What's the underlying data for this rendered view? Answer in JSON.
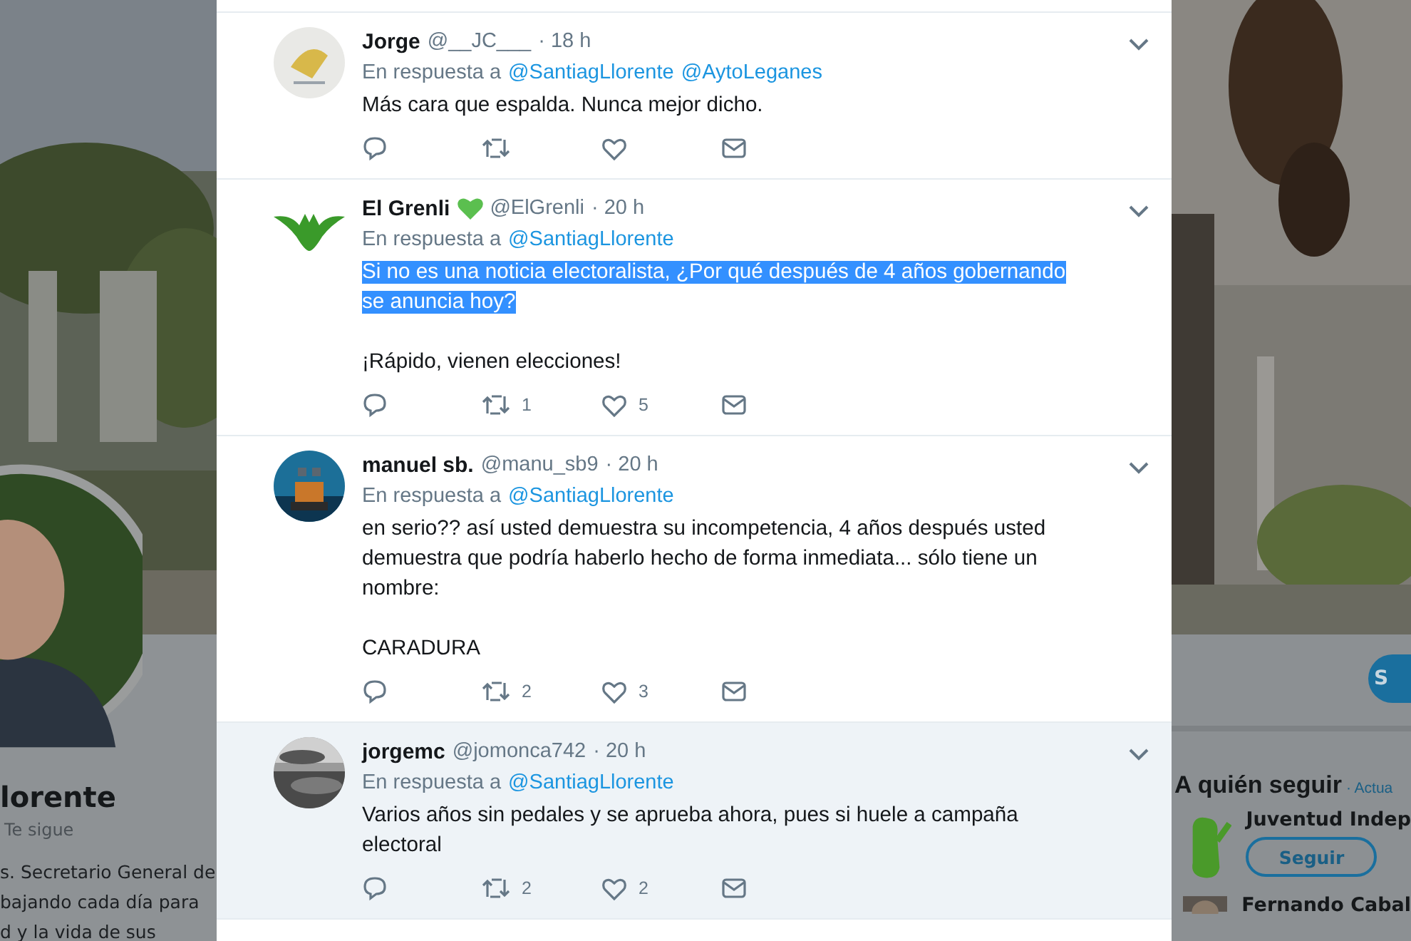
{
  "profile_backdrop": {
    "name": "lorente",
    "follows_you": "Te sigue",
    "bio_lines": [
      "s. Secretario General de",
      "bajando cada día para",
      "d y la vida de sus"
    ]
  },
  "sidebar": {
    "action_button": "S",
    "who_to_follow": {
      "title": "A quién seguir",
      "refresh": "· Actua",
      "accounts": [
        {
          "name": "Juventud Indep",
          "follow_button": "Seguir"
        },
        {
          "name": "Fernando Cabal"
        }
      ]
    }
  },
  "replies": [
    {
      "name": "Jorge",
      "handle": "@__JC___",
      "time": "· 18 h",
      "reply_label": "En respuesta a",
      "reply_to": [
        "@SantiagLlorente",
        "@AytoLeganes"
      ],
      "hovered": false,
      "paragraphs": [
        {
          "text": "Más cara que espalda. Nunca mejor dicho.",
          "highlighted": false
        }
      ]
    },
    {
      "name": "El Grenli",
      "heart_badge": true,
      "handle": "@ElGrenli",
      "time": "· 20 h",
      "reply_label": "En respuesta a",
      "reply_to": [
        "@SantiagLlorente"
      ],
      "hovered": false,
      "paragraphs": [
        {
          "text": "Si no es una noticia electoralista, ¿Por qué después de 4 años gobernando se anuncia hoy?",
          "highlighted": true
        },
        {
          "text": "¡Rápido, vienen elecciones!",
          "highlighted": false
        }
      ],
      "retweets": "1",
      "likes": "5"
    },
    {
      "name": "manuel sb.",
      "handle": "@manu_sb9",
      "time": "· 20 h",
      "reply_label": "En respuesta a",
      "reply_to": [
        "@SantiagLlorente"
      ],
      "hovered": false,
      "paragraphs": [
        {
          "text": "en serio?? así usted demuestra su incompetencia, 4 años después usted demuestra que podría haberlo hecho de forma inmediata... sólo tiene un nombre:",
          "highlighted": false
        },
        {
          "text": "CARADURA",
          "highlighted": false
        }
      ],
      "retweets": "2",
      "likes": "3"
    },
    {
      "name": "jorgemc",
      "handle": "@jomonca742",
      "time": "· 20 h",
      "reply_label": "En respuesta a",
      "reply_to": [
        "@SantiagLlorente"
      ],
      "hovered": true,
      "paragraphs": [
        {
          "text": "Varios años sin pedales y se aprueba ahora, pues si huele a campaña electoral",
          "highlighted": false
        }
      ],
      "retweets": "2",
      "likes": "2"
    }
  ]
}
